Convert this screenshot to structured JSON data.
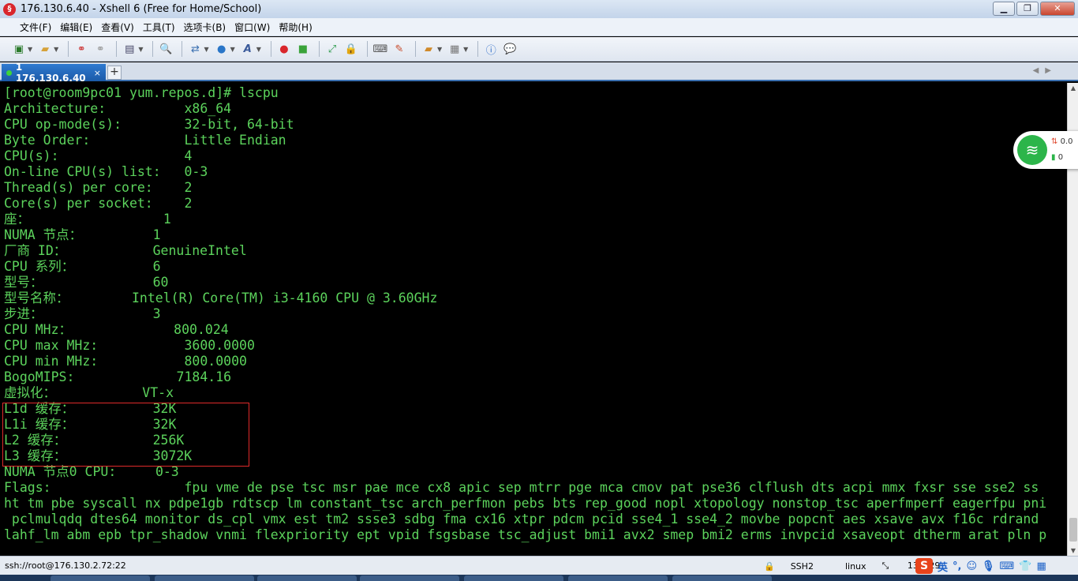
{
  "window": {
    "title": "176.130.6.40 - Xshell 6 (Free for Home/School)"
  },
  "menu": [
    "文件(F)",
    "编辑(E)",
    "查看(V)",
    "工具(T)",
    "选项卡(B)",
    "窗口(W)",
    "帮助(H)"
  ],
  "toolbar": {
    "icons": [
      "new-session-icon",
      "open-icon",
      "connect-icon",
      "disconnect-icon",
      "properties-icon",
      "search-icon",
      "transfer-icon",
      "globe-icon",
      "font-icon",
      "xshell-icon",
      "xftp-icon",
      "fullscreen-icon",
      "lock-icon",
      "keyboard-icon",
      "highlight-icon",
      "compose-icon",
      "layout-icon",
      "help-icon",
      "chat-icon"
    ]
  },
  "tab": {
    "label": "1 176.130.6.40",
    "close": "×",
    "add": "+"
  },
  "terminal": {
    "lines": [
      "[root@room9pc01 yum.repos.d]# lscpu",
      "Architecture:          x86_64",
      "CPU op-mode(s):        32-bit, 64-bit",
      "Byte Order:            Little Endian",
      "CPU(s):                4",
      "On-line CPU(s) list:   0-3",
      "Thread(s) per core:    2",
      "Core(s) per socket:    2",
      "座：                 1",
      "NUMA 节点：         1",
      "厂商 ID：           GenuineIntel",
      "CPU 系列：          6",
      "型号：              60",
      "型号名称：        Intel(R) Core(TM) i3-4160 CPU @ 3.60GHz",
      "步进：              3",
      "CPU MHz：             800.024",
      "CPU max MHz:           3600.0000",
      "CPU min MHz:           800.0000",
      "BogoMIPS:             7184.16",
      "虚拟化：           VT-x",
      "L1d 缓存：          32K",
      "L1i 缓存：          32K",
      "L2 缓存：           256K",
      "L3 缓存：           3072K",
      "NUMA 节点0 CPU:     0-3",
      "Flags:                 fpu vme de pse tsc msr pae mce cx8 apic sep mtrr pge mca cmov pat pse36 clflush dts acpi mmx fxsr sse sse2 ss",
      "ht tm pbe syscall nx pdpe1gb rdtscp lm constant_tsc arch_perfmon pebs bts rep_good nopl xtopology nonstop_tsc aperfmperf eagerfpu pni",
      " pclmulqdq dtes64 monitor ds_cpl vmx est tm2 ssse3 sdbg fma cx16 xtpr pdcm pcid sse4_1 sse4_2 movbe popcnt aes xsave avx f16c rdrand",
      "lahf_lm abm epb tpr_shadow vnmi flexpriority ept vpid fsgsbase tsc_adjust bmi1 avx2 smep bmi2 erms invpcid xsaveopt dtherm arat pln p"
    ]
  },
  "wifi_widget": {
    "speed": "0.0",
    "count": "0"
  },
  "status": {
    "connection": "ssh://root@176.130.2.72:22",
    "protocol": "SSH2",
    "term": "linux",
    "size": "133x29",
    "ime_lang": "英"
  }
}
